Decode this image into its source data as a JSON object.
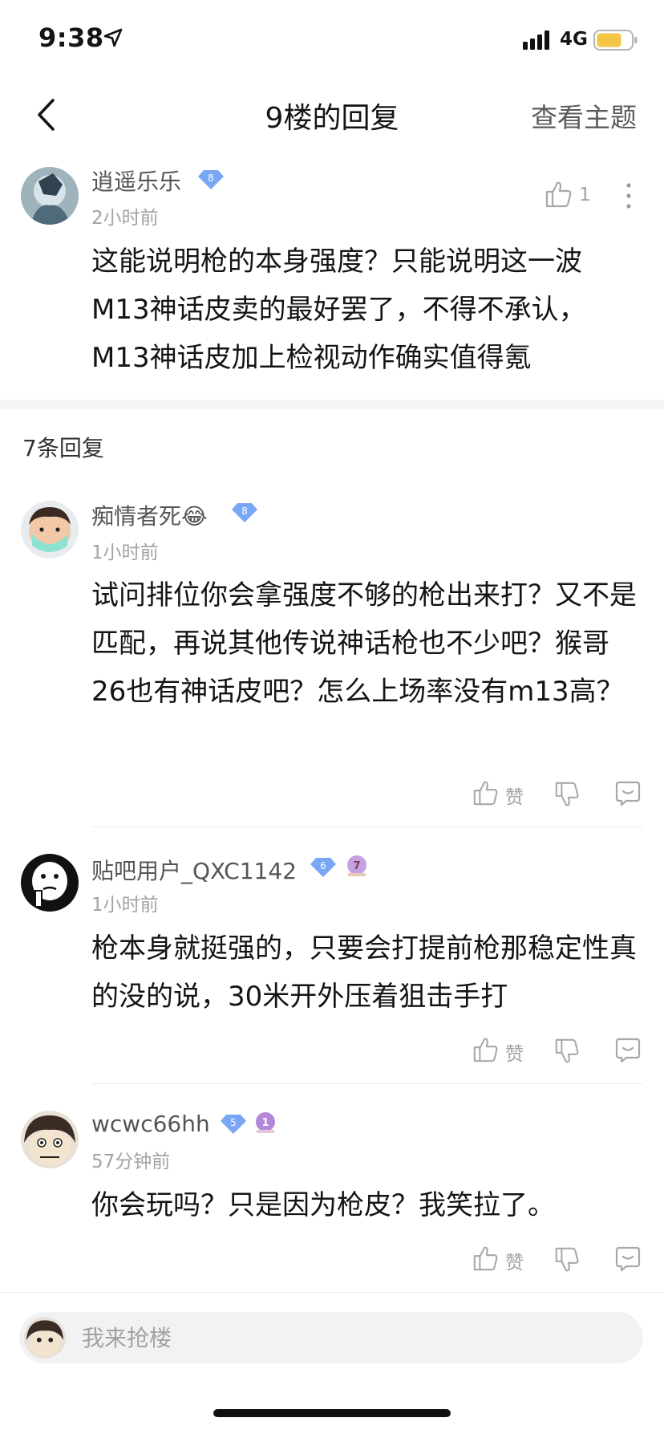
{
  "status_bar": {
    "time": "9:38",
    "network": "4G"
  },
  "nav": {
    "title": "9楼的回复",
    "action": "查看主题"
  },
  "main_post": {
    "username": "逍遥乐乐",
    "level": "8",
    "time": "2小时前",
    "likes": "1",
    "content": "这能说明枪的本身强度？只能说明这一波M13神话皮卖的最好罢了，不得不承认，M13神话皮加上检视动作确实值得氪"
  },
  "replies_header": "7条回复",
  "replies": [
    {
      "username": "痴情者死😂",
      "level": "8",
      "time": "1小时前",
      "content": "试问排位你会拿强度不够的枪出来打？又不是匹配，再说其他传说神话枪也不少吧？猴哥26也有神话皮吧？怎么上场率没有m13高？",
      "like_label": "赞"
    },
    {
      "username": "贴吧用户_QXC1142",
      "level": "6",
      "badge": "7",
      "time": "1小时前",
      "content": "枪本身就挺强的，只要会打提前枪那稳定性真的没的说，30米开外压着狙击手打",
      "like_label": "赞"
    },
    {
      "username": "wcwc66hh",
      "level": "5",
      "badge": "1",
      "time": "57分钟前",
      "content": "你会玩吗？只是因为枪皮？我笑拉了。",
      "like_label": "赞"
    }
  ],
  "input": {
    "placeholder": "我来抢楼"
  },
  "colors": {
    "level_badge": "#7aa7f5",
    "purple_badge": "#b388d8",
    "battery": "#f5c544"
  }
}
